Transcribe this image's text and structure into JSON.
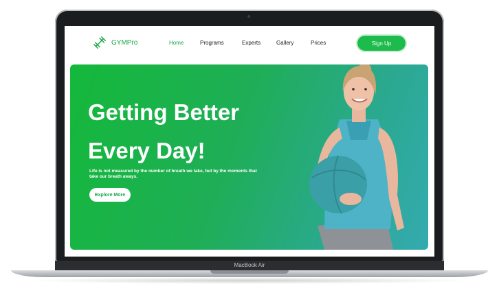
{
  "nav": {
    "logo_text": "GYMPro",
    "links": [
      {
        "label": "Home",
        "active": true
      },
      {
        "label": "Programs",
        "active": false
      },
      {
        "label": "Experts",
        "active": false
      },
      {
        "label": "Gallery",
        "active": false
      },
      {
        "label": "Prices",
        "active": false
      }
    ],
    "signup_label": "Sign Up"
  },
  "hero": {
    "title_line1": "Getting Better",
    "title_line2": "Every Day!",
    "subtitle": "Life is not measured by the number of breath we take, but by the moments that take our breath aways.",
    "button_label": "Explore More"
  },
  "device": {
    "label": "MacBook Air"
  },
  "colors": {
    "accent": "#1dbb4c",
    "hero_start": "#14b83a",
    "hero_end": "#34aab0"
  }
}
